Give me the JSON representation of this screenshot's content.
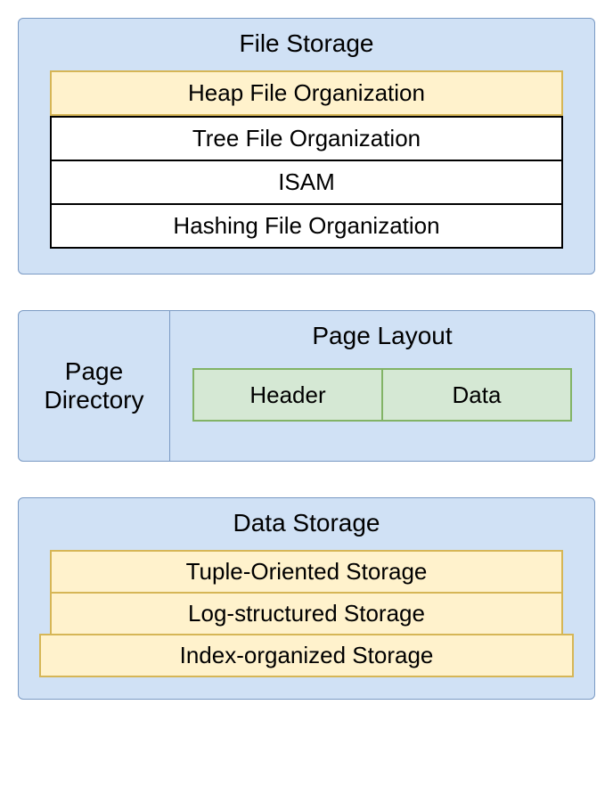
{
  "file_storage": {
    "title": "File Storage",
    "items": [
      "Heap File Organization",
      "Tree File Organization",
      "ISAM",
      "Hashing File Organization"
    ]
  },
  "page_directory": {
    "label": "Page Directory"
  },
  "page_layout": {
    "title": "Page Layout",
    "cells": [
      "Header",
      "Data"
    ]
  },
  "data_storage": {
    "title": "Data Storage",
    "items": [
      "Tuple-Oriented Storage",
      "Log-structured Storage",
      "Index-organized Storage"
    ]
  }
}
